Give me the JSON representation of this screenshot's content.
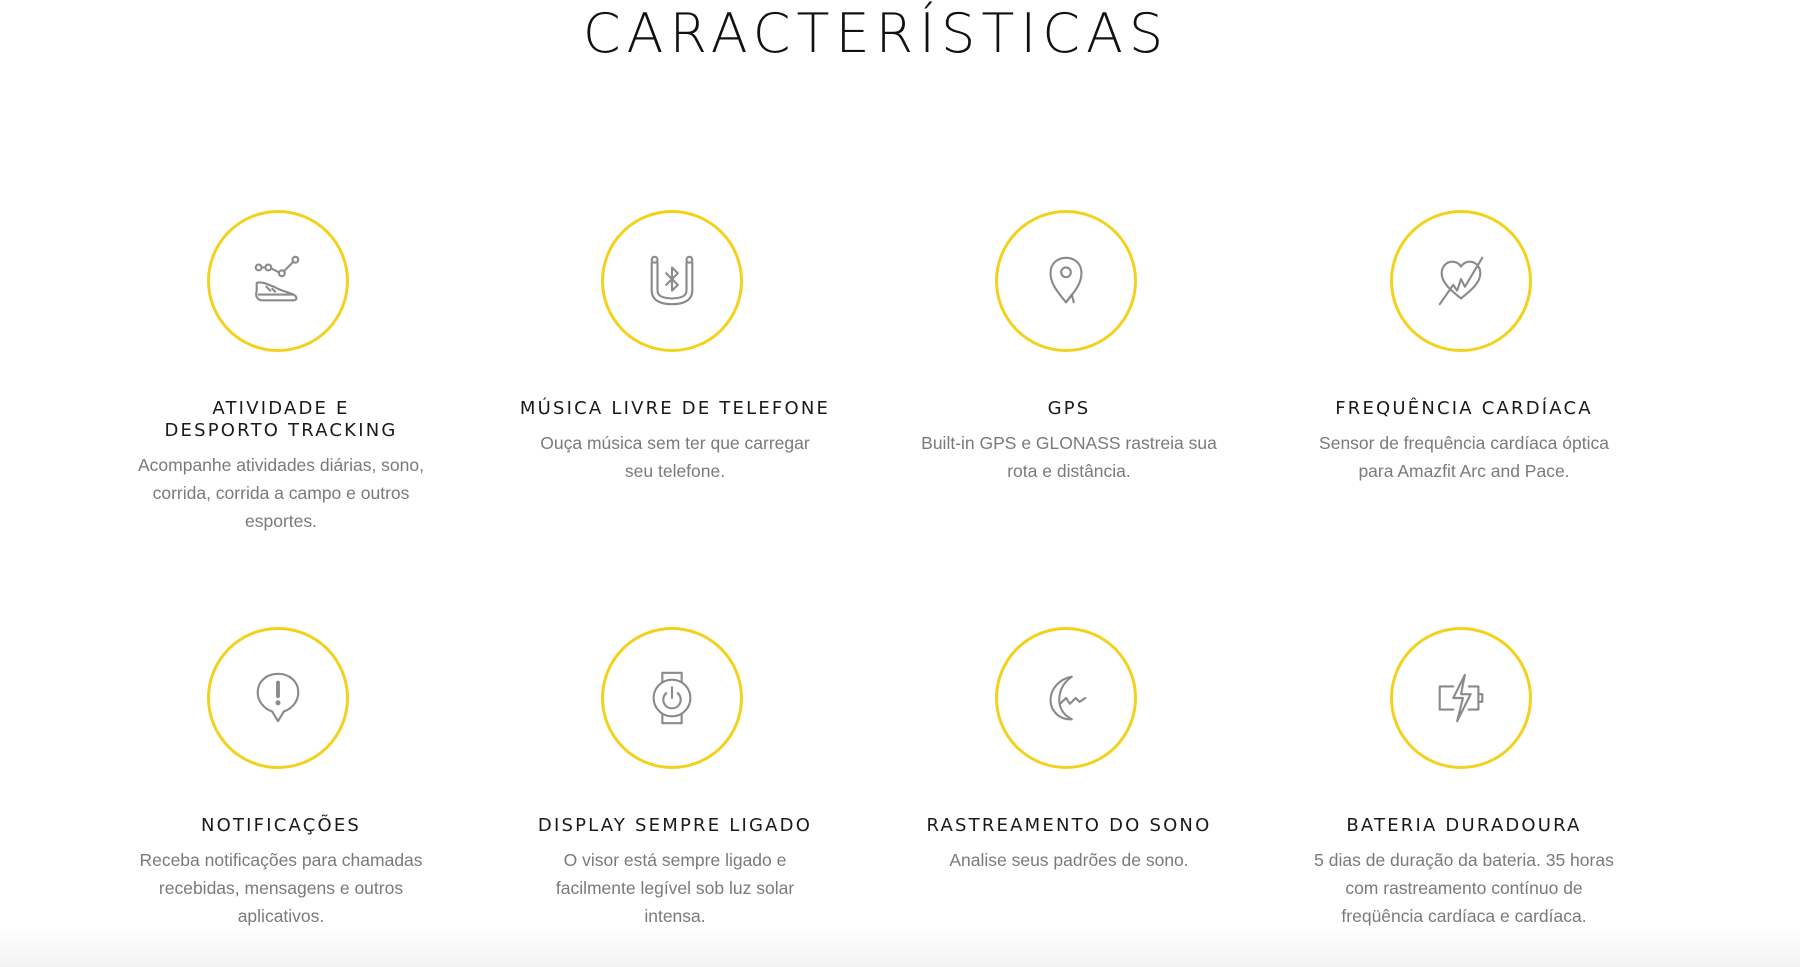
{
  "section": {
    "title": "CARACTERÍSTICAS"
  },
  "accent_color": "#f2d21c",
  "features": [
    {
      "icon": "sneaker-activity-icon",
      "title": "ATIVIDADE E DESPORTO TRACKING",
      "description": "Acompanhe atividades diárias, sono, corrida, corrida a campo e outros esportes."
    },
    {
      "icon": "bluetooth-earphones-icon",
      "title": "MÚSICA LIVRE DE TELEFONE",
      "description": "Ouça música sem ter que carregar seu telefone."
    },
    {
      "icon": "map-pin-icon",
      "title": "GPS",
      "description": "Built-in GPS e GLONASS rastreia sua rota e distância."
    },
    {
      "icon": "heart-rate-icon",
      "title": "FREQUÊNCIA CARDÍACA",
      "description": "Sensor de frequência cardíaca óptica para Amazfit Arc and Pace."
    },
    {
      "icon": "notification-bubble-icon",
      "title": "NOTIFICAÇÕES",
      "description": "Receba notificações para chamadas recebidas, mensagens e outros aplicativos."
    },
    {
      "icon": "watch-power-icon",
      "title": "DISPLAY SEMPRE LIGADO",
      "description": "O visor está sempre ligado e facilmente legível sob luz solar intensa."
    },
    {
      "icon": "moon-sleep-icon",
      "title": "RASTREAMENTO DO SONO",
      "description": "Analise seus padrões de sono."
    },
    {
      "icon": "battery-bolt-icon",
      "title": "BATERIA DURADOURA",
      "description": "5 dias de duração da bateria. 35 horas com rastreamento contínuo de freqüência cardíaca e cardíaca."
    }
  ]
}
